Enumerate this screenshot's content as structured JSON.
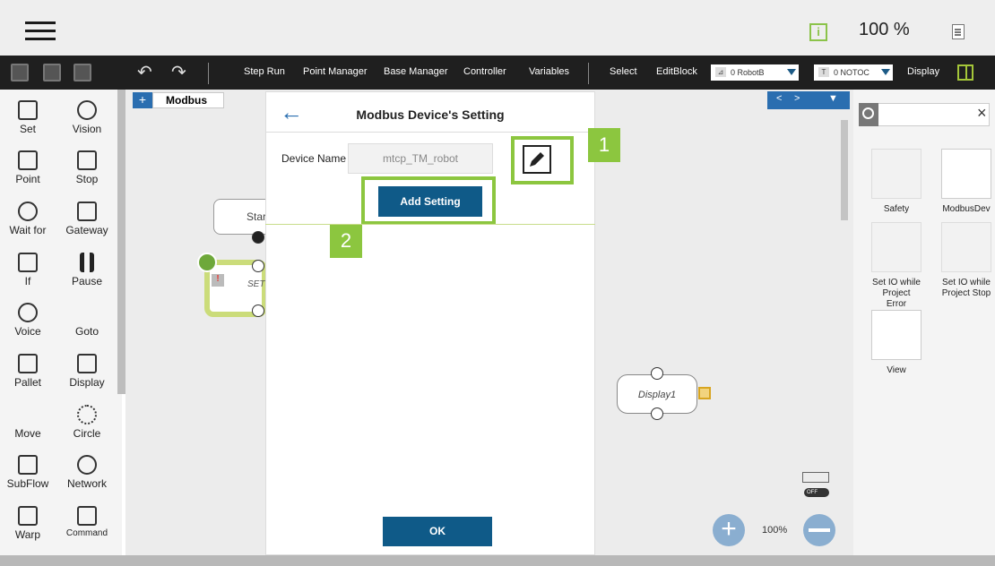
{
  "topbar": {
    "info_icon_label": "i",
    "zoom": "100 %"
  },
  "toolbar": {
    "step_run": "Step Run",
    "point_manager": "Point Manager",
    "base_manager": "Base Manager",
    "controller": "Controller",
    "variables": "Variables",
    "select": "Select",
    "edit_block": "EditBlock",
    "robot_base": "0 RobotB",
    "tool": "0 NOTOC",
    "tool_prefix": "T",
    "display": "Display"
  },
  "palette": {
    "items": [
      {
        "label": "Set"
      },
      {
        "label": "Vision"
      },
      {
        "label": "Point"
      },
      {
        "label": "Stop"
      },
      {
        "label": "Wait for"
      },
      {
        "label": "Gateway"
      },
      {
        "label": "If"
      },
      {
        "label": "Pause"
      },
      {
        "label": "Voice"
      },
      {
        "label": "Goto"
      },
      {
        "label": "Pallet"
      },
      {
        "label": "Display"
      },
      {
        "label": "Move"
      },
      {
        "label": "Circle"
      },
      {
        "label": "SubFlow"
      },
      {
        "label": "Network"
      },
      {
        "label": "Warp"
      },
      {
        "label": "Command"
      }
    ]
  },
  "canvas": {
    "tab_plus": "+",
    "tab_label": "Modbus",
    "start_node": "Star",
    "set_node": "SET",
    "display_node": "Display1",
    "zoom": "100%",
    "toggle": "OFF"
  },
  "dialog": {
    "title": "Modbus Device's Setting",
    "device_name_label": "Device Name",
    "device_name_value": "mtcp_TM_robot",
    "add_setting": "Add Setting",
    "ok": "OK",
    "badge_1": "1",
    "badge_2": "2"
  },
  "right_panel": {
    "components": [
      {
        "label": "Safety"
      },
      {
        "label": "ModbusDev"
      },
      {
        "label": "Set IO while Project Error"
      },
      {
        "label": "Set IO while Project Stop"
      },
      {
        "label": "View"
      }
    ]
  },
  "colors": {
    "accent_green": "#8cc63f",
    "primary_blue": "#0f5a88",
    "toolbar_bg": "#1f1f1f"
  }
}
